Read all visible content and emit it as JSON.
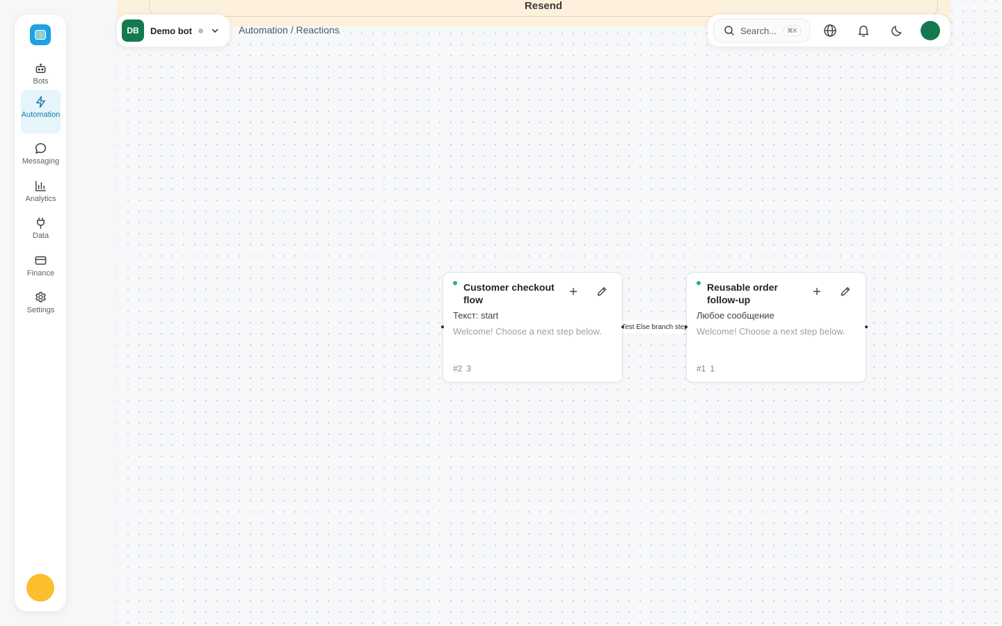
{
  "banner": {
    "text": "Resend"
  },
  "sidebar": {
    "items": [
      {
        "label": "Bots",
        "icon": "robot-icon"
      },
      {
        "label": "Automation",
        "icon": "lightning-icon",
        "active": true
      },
      {
        "label": "Messaging",
        "icon": "chat-bubble-icon"
      },
      {
        "label": "Analytics",
        "icon": "bar-chart-icon"
      },
      {
        "label": "Data",
        "icon": "plug-icon"
      },
      {
        "label": "Finance",
        "icon": "credit-card-icon"
      },
      {
        "label": "Settings",
        "icon": "gear-icon"
      }
    ]
  },
  "bot": {
    "initials": "DB",
    "name": "Demo bot"
  },
  "breadcrumb": "Automation / Reactions",
  "search": {
    "placeholder": "Search...",
    "shortcut": "⌘K"
  },
  "colors": {
    "accent": "#1da1e2",
    "brand_green": "#137a4f",
    "status_active": "#22b573",
    "banner_bg": "#fdf1dd",
    "avatar_yellow": "#fbbf2e"
  },
  "nodes": [
    {
      "title": "Customer checkout flow",
      "trigger": "Текст: start",
      "message": "Welcome! Choose a next step below.",
      "id": "#2",
      "count": "3"
    },
    {
      "title": "Reusable order follow-up",
      "trigger": "Любое сообщение",
      "message": "Welcome! Choose a next step below.",
      "id": "#1",
      "count": "1"
    }
  ],
  "edge": {
    "label": "Test Else branch step"
  }
}
